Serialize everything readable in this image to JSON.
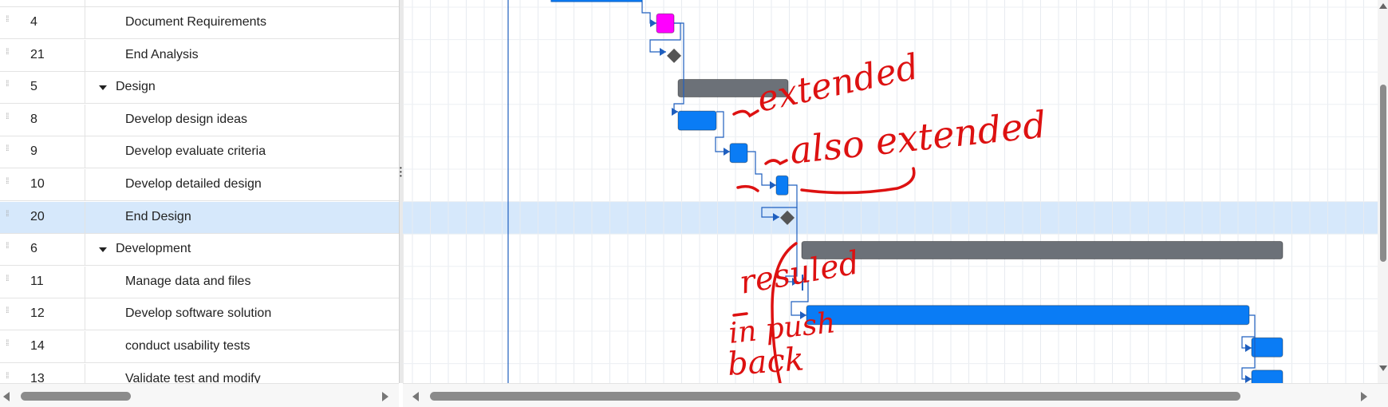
{
  "grid": {
    "rows": [
      {
        "id": "4",
        "name": "Document Requirements",
        "level": 1,
        "parent": false,
        "selected": false
      },
      {
        "id": "21",
        "name": "End Analysis",
        "level": 1,
        "parent": false,
        "selected": false
      },
      {
        "id": "5",
        "name": "Design",
        "level": 0,
        "parent": true,
        "selected": false
      },
      {
        "id": "8",
        "name": "Develop design ideas",
        "level": 1,
        "parent": false,
        "selected": false
      },
      {
        "id": "9",
        "name": "Develop evaluate criteria",
        "level": 1,
        "parent": false,
        "selected": false
      },
      {
        "id": "10",
        "name": "Develop detailed design",
        "level": 1,
        "parent": false,
        "selected": false
      },
      {
        "id": "20",
        "name": "End Design",
        "level": 1,
        "parent": false,
        "selected": true
      },
      {
        "id": "6",
        "name": "Development",
        "level": 0,
        "parent": true,
        "selected": false
      },
      {
        "id": "11",
        "name": "Manage data and files",
        "level": 1,
        "parent": false,
        "selected": false
      },
      {
        "id": "12",
        "name": "Develop software solution",
        "level": 1,
        "parent": false,
        "selected": false
      },
      {
        "id": "14",
        "name": "conduct usability tests",
        "level": 1,
        "parent": false,
        "selected": false
      },
      {
        "id": "13",
        "name": "Validate test and modify",
        "level": 1,
        "parent": false,
        "selected": false
      }
    ]
  },
  "annotations": {
    "note1": "extended",
    "note2": "also extended",
    "note3_line1": "resuled",
    "note3_line2": "in push",
    "note3_line3": "back"
  },
  "colors": {
    "task": "#0a7cf5",
    "summary": "#6c7178",
    "milestone": "#555555",
    "highlight_task": "#ff00ff",
    "annotation_ink": "#dd1111",
    "selected_row": "#d6e8fb",
    "link": "#1f5fbf"
  }
}
